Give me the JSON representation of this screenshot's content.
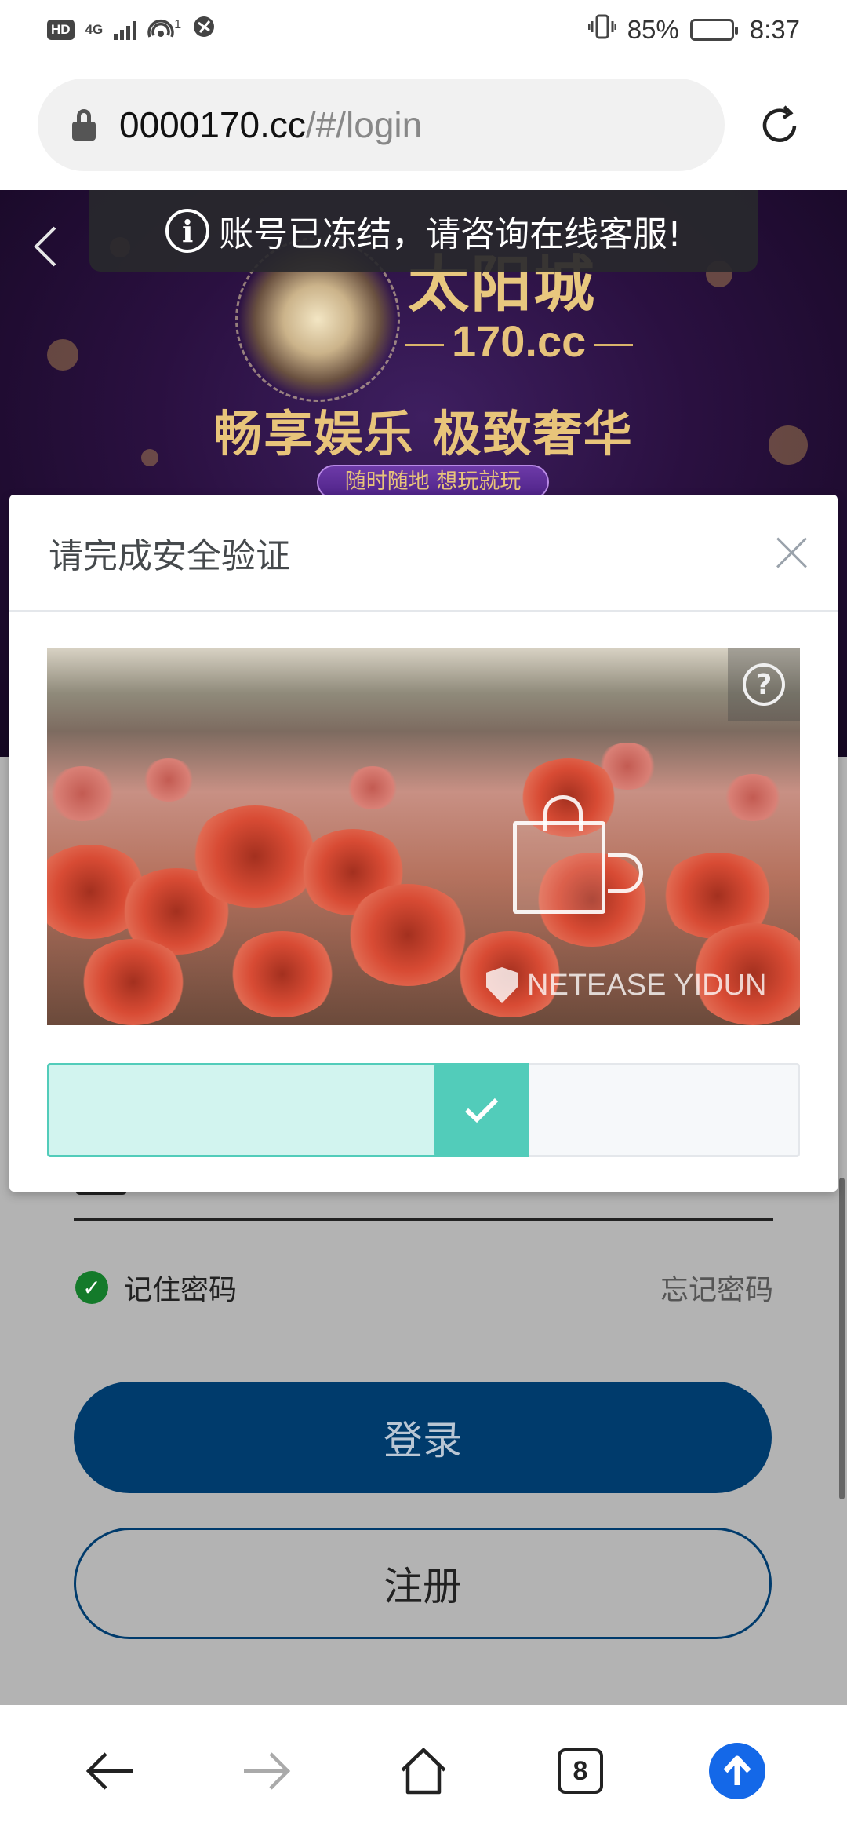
{
  "status_bar": {
    "hd": "HD",
    "network": "4G",
    "hotspot_count": "1",
    "battery_percent": "85%",
    "battery_level": 0.85,
    "time": "8:37"
  },
  "address_bar": {
    "url_host": "0000170.cc",
    "url_path": "/#/login"
  },
  "banner": {
    "brand_name": "太阳城",
    "brand_domain": "170.cc",
    "slogan": "畅享娱乐 极致奢华",
    "sub_slogan": "随时随地 想玩就玩"
  },
  "toast": {
    "icon": "info-icon",
    "message": "账号已冻结，请咨询在线客服!"
  },
  "captcha": {
    "title": "请完成安全验证",
    "help_symbol": "?",
    "watermark": "NETEASE YIDUN",
    "slider_progress": 0.64,
    "slider_status": "success",
    "colors": {
      "accent": "#52ccba",
      "fill": "#d2f4ef"
    }
  },
  "login_form": {
    "remember_label": "记住密码",
    "remember_checked": true,
    "forgot_label": "忘记密码",
    "login_button": "登录",
    "register_button": "注册",
    "colors": {
      "primary": "#003b6c"
    }
  },
  "bottom_nav": {
    "tabs_count": "8",
    "items": [
      "back-icon",
      "forward-icon",
      "home-icon",
      "tabs-icon",
      "upload-icon"
    ]
  }
}
